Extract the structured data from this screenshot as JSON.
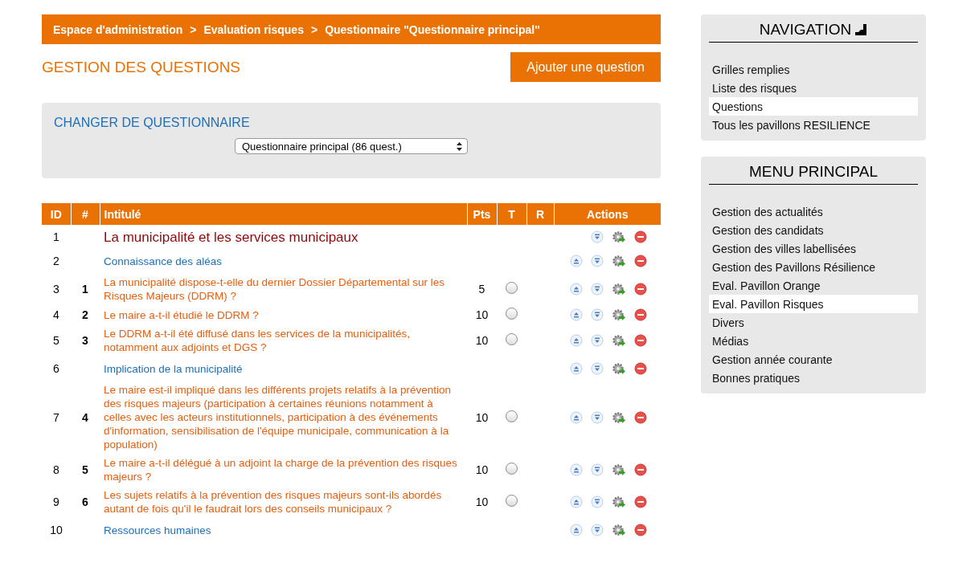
{
  "breadcrumb": [
    "Espace d'administration",
    "Evaluation risques",
    "Questionnaire \"Questionnaire principal\""
  ],
  "breadcrumb_separator": ">",
  "page_title": "GESTION DES QUESTIONS",
  "add_button": "Ajouter une question",
  "change_panel": {
    "title": "CHANGER DE QUESTIONNAIRE",
    "select_value": "Questionnaire principal (86 quest.)"
  },
  "table": {
    "columns": [
      "ID",
      "#",
      "Intitulé",
      "Pts",
      "T",
      "R",
      "Actions"
    ],
    "rows": [
      {
        "kind": "chapter",
        "id": "1",
        "text": "La municipalité et les services municipaux",
        "up": false
      },
      {
        "kind": "section",
        "id": "2",
        "text": "Connaissance des aléas",
        "up": true
      },
      {
        "kind": "question",
        "id": "3",
        "num": "1",
        "text": "La municipalité dispose-t-elle du dernier Dossier Départemental sur les Risques Majeurs (DDRM) ?",
        "pts": "5",
        "checked": false,
        "up": true
      },
      {
        "kind": "question",
        "id": "4",
        "num": "2",
        "text": "Le maire a-t-il étudié le DDRM ?",
        "pts": "10",
        "checked": false,
        "up": true
      },
      {
        "kind": "question",
        "id": "5",
        "num": "3",
        "text": "Le DDRM a-t-il été diffusé dans les services de la municipalités, notamment aux adjoints et DGS ?",
        "pts": "10",
        "checked": false,
        "up": true
      },
      {
        "kind": "section",
        "id": "6",
        "text": "Implication de la municipalité",
        "up": true
      },
      {
        "kind": "question",
        "id": "7",
        "num": "4",
        "text": "Le maire est-il impliqué dans les différents projets relatifs à la prévention des risques majeurs (participation à certaines réunions notamment à celles avec les acteurs institutionnels, participation à des événements d'information, sensibilisation de l'équipe municipale, communication à la population)",
        "pts": "10",
        "checked": false,
        "up": true
      },
      {
        "kind": "question",
        "id": "8",
        "num": "5",
        "text": "Le maire a-t-il délégué à un adjoint la charge de la prévention des risques majeurs ?",
        "pts": "10",
        "checked": false,
        "up": true
      },
      {
        "kind": "question",
        "id": "9",
        "num": "6",
        "text": "Les sujets relatifs à la prévention des risques majeurs sont-ils abordés autant de fois qu'il le faudrait lors des conseils municipaux ?",
        "pts": "10",
        "checked": false,
        "up": true
      },
      {
        "kind": "section",
        "id": "10",
        "text": "Ressources humaines",
        "up": true
      }
    ]
  },
  "navigation": {
    "title": "NAVIGATION",
    "items": [
      {
        "label": "Grilles remplies",
        "selected": false
      },
      {
        "label": "Liste des risques",
        "selected": false
      },
      {
        "label": "Questions",
        "selected": true
      },
      {
        "label": "Tous les pavillons RESILIENCE",
        "selected": false
      }
    ]
  },
  "main_menu": {
    "title": "MENU PRINCIPAL",
    "items": [
      {
        "label": "Gestion des actualités",
        "selected": false
      },
      {
        "label": "Gestion des candidats",
        "selected": false
      },
      {
        "label": "Gestion des villes labellisées",
        "selected": false
      },
      {
        "label": "Gestion des Pavillons Résilience",
        "selected": false
      },
      {
        "label": "Eval. Pavillon Orange",
        "selected": false
      },
      {
        "label": "Eval. Pavillon Risques",
        "selected": true
      },
      {
        "label": "Divers",
        "selected": false
      },
      {
        "label": "Médias",
        "selected": false
      },
      {
        "label": "Gestion année courante",
        "selected": false
      },
      {
        "label": "Bonnes pratiques",
        "selected": false
      }
    ]
  }
}
